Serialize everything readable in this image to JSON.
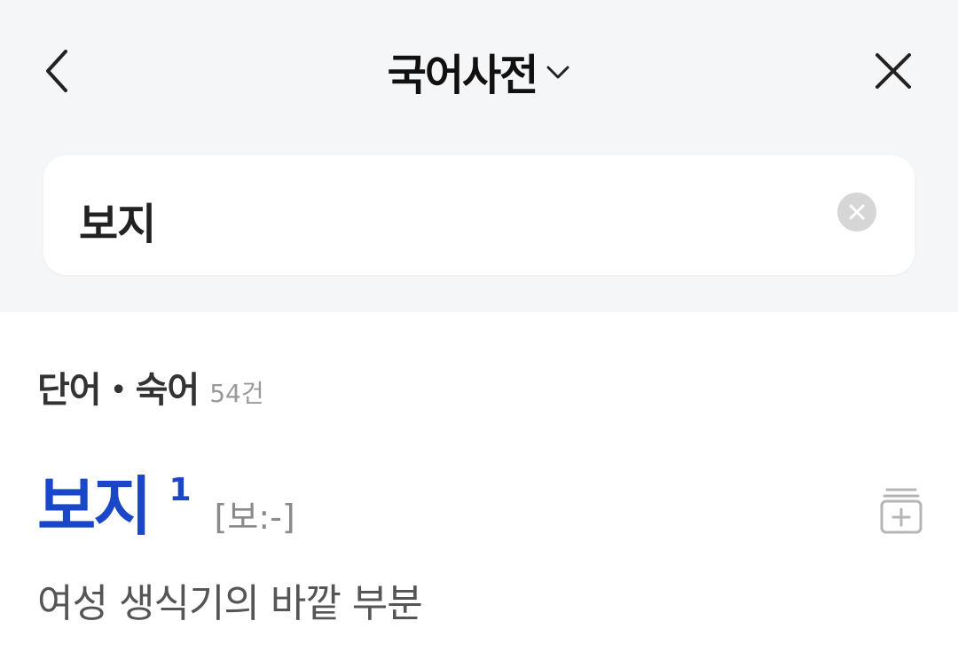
{
  "header": {
    "back_icon": "chevron-left-icon",
    "title": "국어사전",
    "dropdown_icon": "chevron-down-icon",
    "close_icon": "close-icon"
  },
  "search": {
    "value": "보지",
    "clear_icon": "clear-circle-icon"
  },
  "section": {
    "title": "단어・숙어",
    "count": "54건"
  },
  "entry": {
    "word": "보지",
    "superscript": "1",
    "pronunciation": "[보:-]",
    "definition": "여성 생식기의 바깥 부분",
    "wordbook_icon": "add-to-wordbook-icon"
  },
  "colors": {
    "header_bg": "#f5f6f8",
    "accent": "#1a47c8",
    "muted": "#999999"
  }
}
